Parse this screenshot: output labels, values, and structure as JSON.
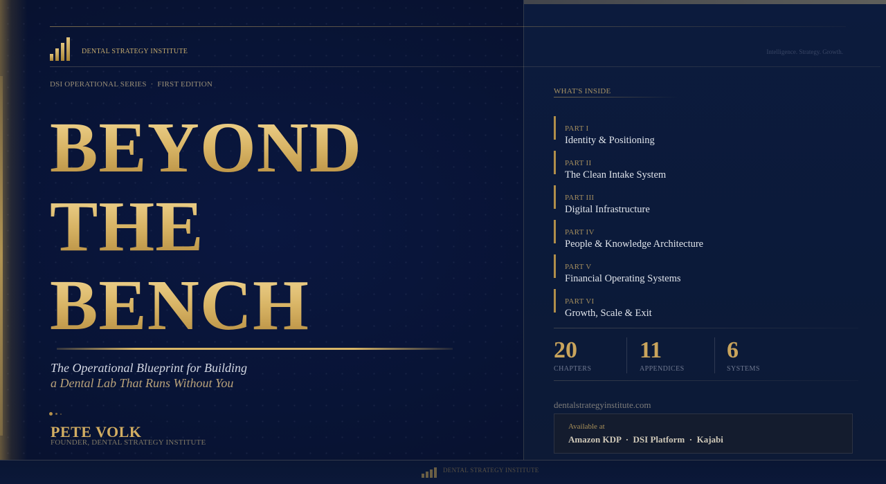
{
  "brand": {
    "name": "DENTAL STRATEGY INSTITUTE",
    "tagline": "Intelligence. Strategy. Growth."
  },
  "cover": {
    "series": "DSI OPERATIONAL SERIES  ·  FIRST EDITION",
    "title_lines": [
      "BEYOND",
      "THE",
      "BENCH"
    ],
    "subtitle_lines": [
      "The Operational Blueprint for Building",
      "a Dental Lab That Runs Without You"
    ],
    "author": "PETE VOLK",
    "author_role": "FOUNDER, DENTAL STRATEGY INSTITUTE"
  },
  "contents": {
    "label": "WHAT'S INSIDE",
    "parts": [
      {
        "part": "PART I",
        "name": "Identity & Positioning"
      },
      {
        "part": "PART II",
        "name": "The Clean Intake System"
      },
      {
        "part": "PART III",
        "name": "Digital Infrastructure"
      },
      {
        "part": "PART IV",
        "name": "People & Knowledge Architecture"
      },
      {
        "part": "PART V",
        "name": "Financial Operating Systems"
      },
      {
        "part": "PART VI",
        "name": "Growth, Scale & Exit"
      }
    ]
  },
  "stats": [
    {
      "value": "20",
      "label": "CHAPTERS"
    },
    {
      "value": "11",
      "label": "APPENDICES"
    },
    {
      "value": "6",
      "label": "SYSTEMS"
    }
  ],
  "website": "dentalstrategyinstitute.com",
  "availability": {
    "label": "Available at",
    "stores": "Amazon KDP  ·  DSI Platform  ·  Kajabi"
  },
  "footer": {
    "text": "DENTAL STRATEGY INSTITUTE"
  },
  "colors": {
    "gold": "#d9b667",
    "navy": "#0a1740"
  }
}
